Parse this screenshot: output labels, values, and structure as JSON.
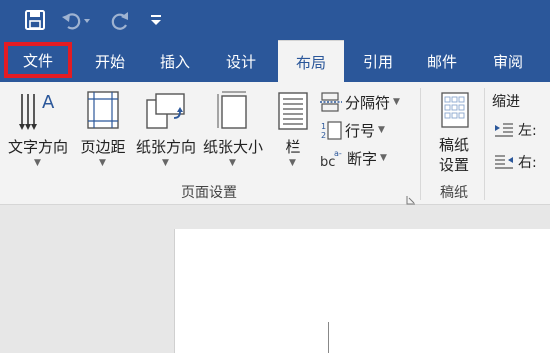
{
  "qat": {
    "save_icon": "save-icon",
    "undo_icon": "undo-icon",
    "redo_icon": "redo-icon",
    "customize_icon": "customize-icon"
  },
  "tabs": [
    "文件",
    "开始",
    "插入",
    "设计",
    "布局",
    "引用",
    "邮件",
    "审阅"
  ],
  "ribbon": {
    "page_setup": {
      "buttons": [
        {
          "label": "文字方向",
          "icon": "text-direction-icon"
        },
        {
          "label": "页边距",
          "icon": "margins-icon"
        },
        {
          "label": "纸张方向",
          "icon": "orientation-icon"
        },
        {
          "label": "纸张大小",
          "icon": "size-icon"
        },
        {
          "label": "栏",
          "icon": "columns-icon"
        }
      ],
      "small_buttons": [
        {
          "label": "分隔符",
          "icon": "breaks-icon"
        },
        {
          "label": "行号",
          "icon": "line-numbers-icon"
        },
        {
          "label": "断字",
          "icon": "hyphenation-icon"
        }
      ],
      "title": "页面设置",
      "launcher_icon": "dialog-launcher-icon"
    },
    "manuscript": {
      "button_line1": "稿纸",
      "button_line2": "设置",
      "title": "稿纸",
      "icon": "manuscript-icon"
    },
    "paragraph": {
      "indent_label": "缩进",
      "left_label": "左:",
      "right_label": "右:",
      "left_icon": "indent-left-icon",
      "right_icon": "indent-right-icon"
    }
  },
  "colors": {
    "accent": "#2b579a",
    "highlight": "#e31c23"
  }
}
